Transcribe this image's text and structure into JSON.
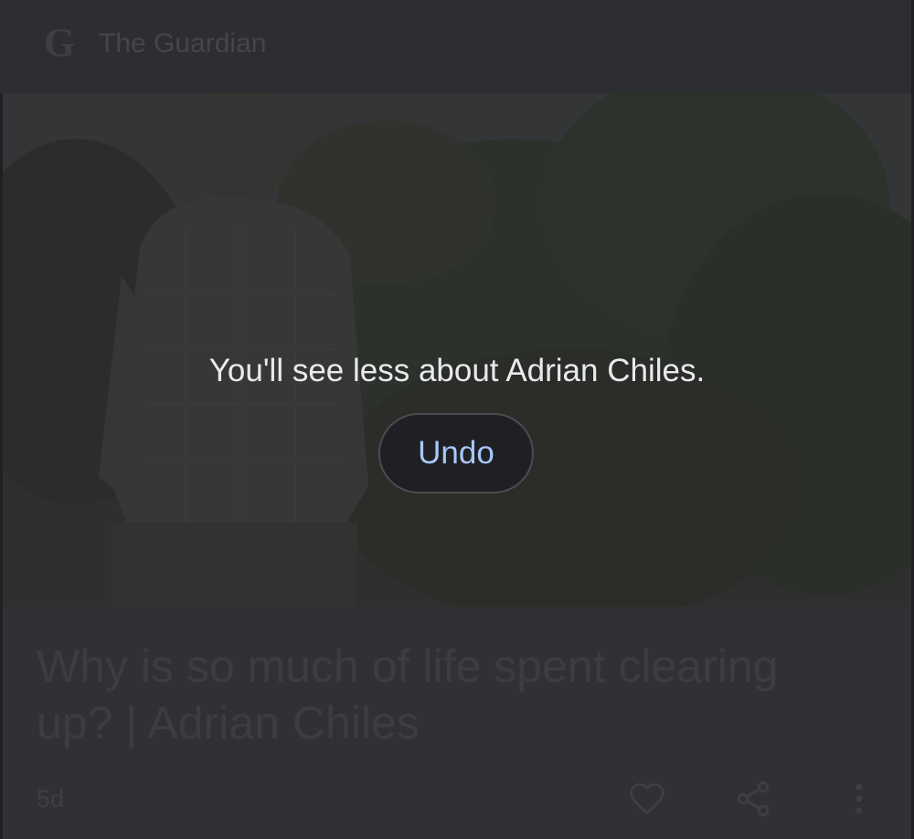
{
  "card": {
    "source_name": "The Guardian",
    "source_logo_letter": "G",
    "headline": "Why is so much of life spent clearing up? | Adrian Chiles",
    "age": "5d"
  },
  "notification": {
    "message": "You'll see less about Adrian Chiles.",
    "undo_label": "Undo"
  },
  "icons": {
    "like": "heart-icon",
    "share": "share-icon",
    "more": "more-vert-icon"
  },
  "colors": {
    "background": "#303135",
    "undo_text": "#a8c7fa",
    "undo_bg": "#1f2023",
    "message_text": "#e9eaee"
  }
}
